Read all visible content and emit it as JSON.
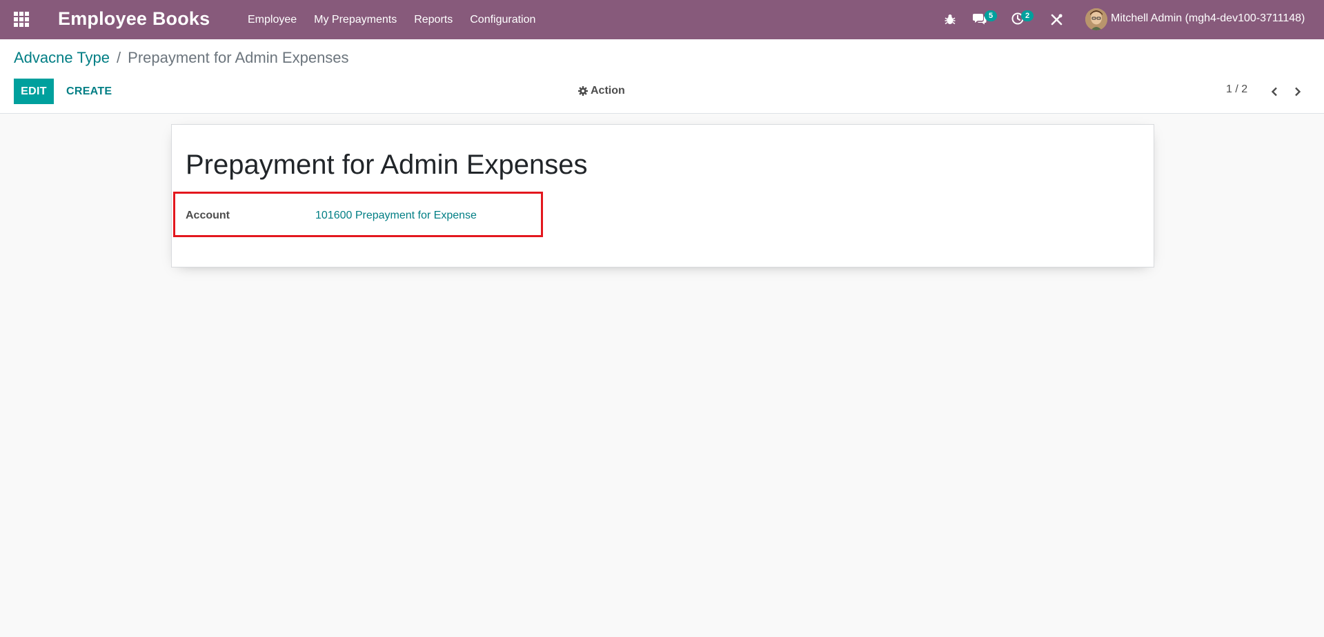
{
  "navbar": {
    "app_title": "Employee Books",
    "menu": [
      "Employee",
      "My Prepayments",
      "Reports",
      "Configuration"
    ],
    "icons": [
      "apps-grid-icon",
      "bug-icon",
      "chat-icon",
      "clock-icon",
      "tools-icon"
    ],
    "messages_badge": "5",
    "activities_badge": "2",
    "user_name": "Mitchell Admin (mgh4-dev100-3711148)",
    "color": "#875a7b"
  },
  "breadcrumb": {
    "parent": "Advacne Type",
    "separator": "/",
    "current": "Prepayment for Admin Expenses"
  },
  "toolbar": {
    "edit_label": "EDIT",
    "create_label": "CREATE",
    "action_label": "Action",
    "pager": "1 / 2"
  },
  "form": {
    "title": "Prepayment for Admin Expenses",
    "fields": [
      {
        "label": "Account",
        "value": "101600 Prepayment for Expense"
      }
    ]
  },
  "colors": {
    "accent": "#00a09d",
    "link": "#017e84",
    "highlight": "#e3171e"
  }
}
